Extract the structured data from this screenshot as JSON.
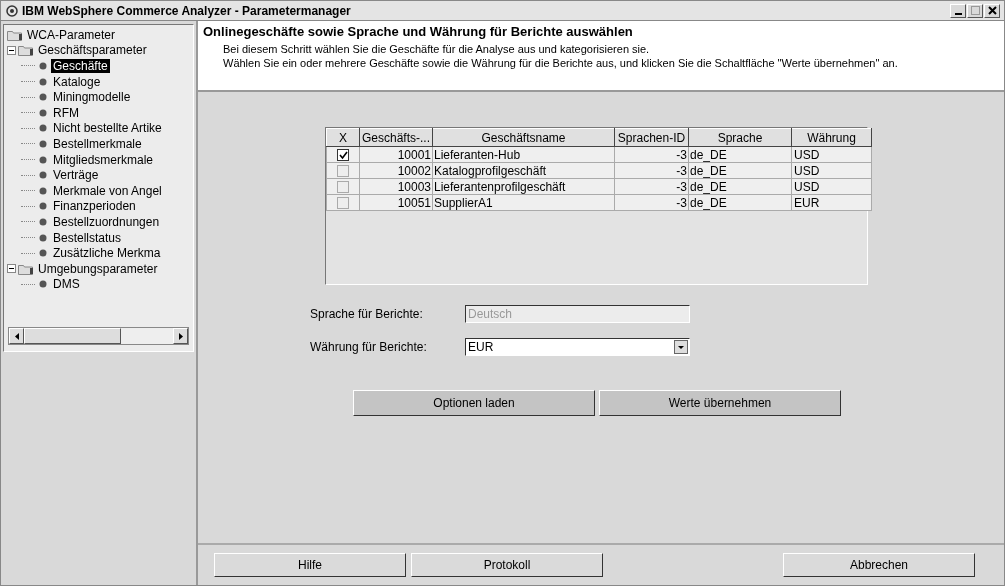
{
  "window": {
    "title": "IBM WebSphere Commerce Analyzer - Parametermanager"
  },
  "tree": {
    "label": "WCA-Parameter",
    "selected": false,
    "children": [
      {
        "label": "Geschäftsparameter",
        "expanded": true,
        "selected": false,
        "children": [
          {
            "label": "Geschäfte",
            "selected": true
          },
          {
            "label": "Kataloge",
            "selected": false
          },
          {
            "label": "Miningmodelle",
            "selected": false
          },
          {
            "label": "RFM",
            "selected": false
          },
          {
            "label": "Nicht bestellte Artike",
            "selected": false
          },
          {
            "label": "Bestellmerkmale",
            "selected": false
          },
          {
            "label": "Mitgliedsmerkmale",
            "selected": false
          },
          {
            "label": "Verträge",
            "selected": false
          },
          {
            "label": "Merkmale von Angel",
            "selected": false
          },
          {
            "label": "Finanzperioden",
            "selected": false
          },
          {
            "label": "Bestellzuordnungen",
            "selected": false
          },
          {
            "label": "Bestellstatus",
            "selected": false
          },
          {
            "label": "Zusätzliche Merkma",
            "selected": false
          }
        ]
      },
      {
        "label": "Umgebungsparameter",
        "expanded": true,
        "selected": false,
        "children": [
          {
            "label": "DMS",
            "selected": false
          }
        ]
      }
    ]
  },
  "header": {
    "title": "Onlinegeschäfte sowie Sprache und Währung für Berichte auswählen",
    "lines": [
      "Bei diesem Schritt wählen Sie die Geschäfte für die Analyse aus und kategorisieren sie.",
      "Wählen Sie ein oder mehrere Geschäfte sowie die Währung für die Berichte aus, und klicken Sie die Schaltfläche \"Werte übernehmen\" an."
    ]
  },
  "table": {
    "check_column": "X",
    "columns": [
      "Geschäfts-...",
      "Geschäftsname",
      "Sprachen-ID",
      "Sprache",
      "Währung"
    ],
    "rows": [
      {
        "checked": true,
        "cells": [
          "10001",
          "Lieferanten-Hub",
          "-3",
          "de_DE",
          "USD"
        ]
      },
      {
        "checked": false,
        "cells": [
          "10002",
          "Katalogprofilgeschäft",
          "-3",
          "de_DE",
          "USD"
        ]
      },
      {
        "checked": false,
        "cells": [
          "10003",
          "Lieferantenprofilgeschäft",
          "-3",
          "de_DE",
          "USD"
        ]
      },
      {
        "checked": false,
        "cells": [
          "10051",
          "SupplierA1",
          "-3",
          "de_DE",
          "EUR"
        ]
      }
    ]
  },
  "language": {
    "label": "Sprache für Berichte:",
    "value": "Deutsch",
    "disabled": true
  },
  "currency": {
    "label": "Währung für Berichte:",
    "value": "EUR"
  },
  "actions": [
    "Optionen laden",
    "Werte übernehmen"
  ],
  "footer_buttons": [
    "Hilfe",
    "Protokoll"
  ],
  "cancel_button": "Abbrechen"
}
